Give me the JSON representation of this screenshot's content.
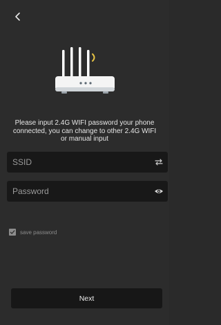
{
  "header": {
    "back_icon": "chevron-left-icon"
  },
  "illustration": {
    "icon": "wifi-router-icon"
  },
  "instruction": {
    "text": "Please input 2.4G WIFI password your phone connected, you can change to other 2.4G WIFI or manual input"
  },
  "form": {
    "ssid": {
      "value": "",
      "placeholder": "SSID",
      "icon": "swap-icon"
    },
    "password": {
      "value": "",
      "placeholder": "Password",
      "icon": "eye-icon"
    },
    "save_password": {
      "label": "save password",
      "checked": true
    }
  },
  "actions": {
    "next_label": "Next"
  },
  "colors": {
    "background": "#2c2c2c",
    "field_background": "#181818",
    "router_accent": "#e8c544"
  }
}
